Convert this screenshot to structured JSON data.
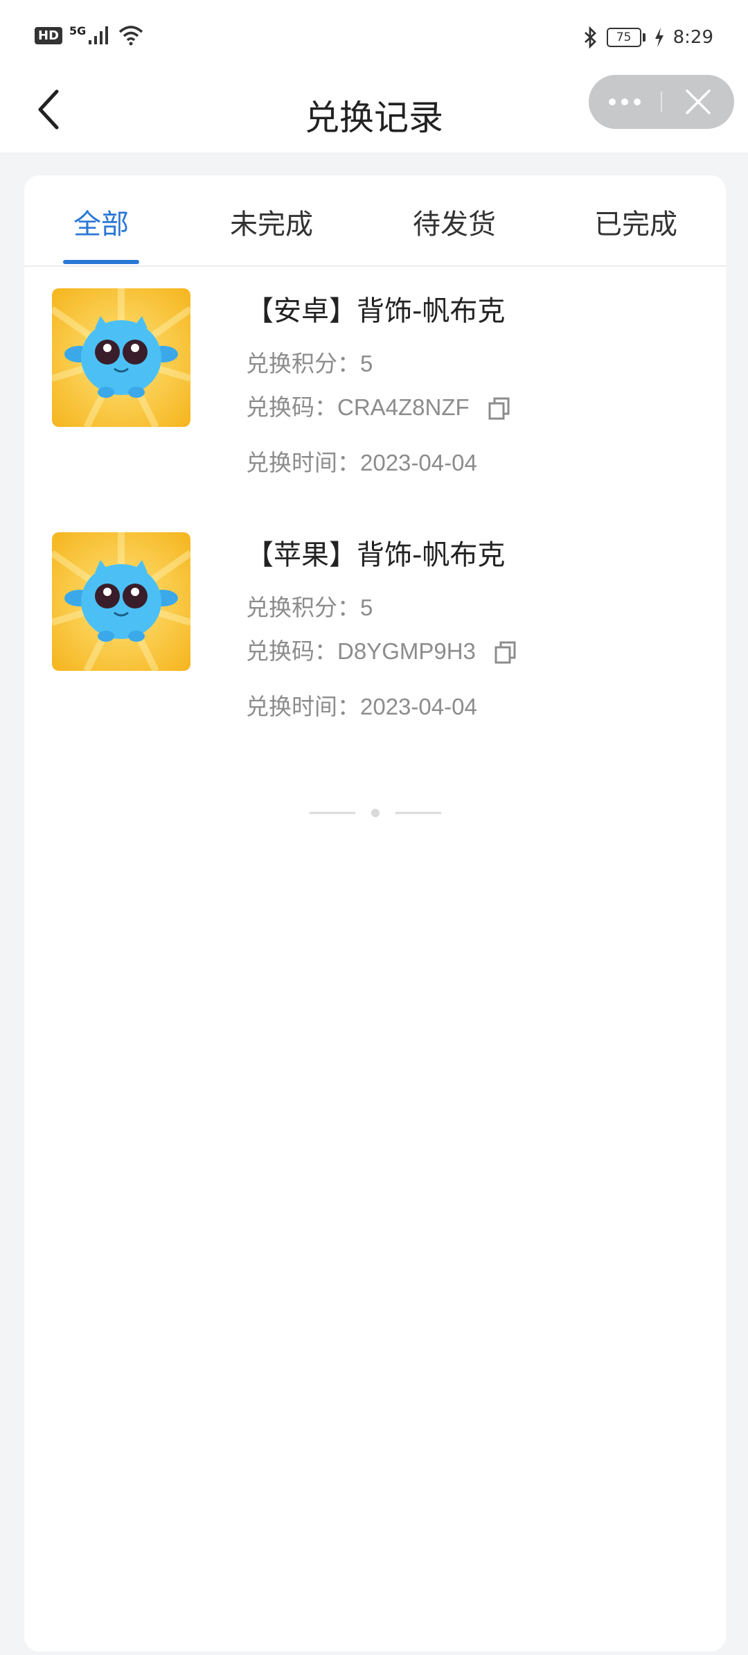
{
  "status_bar": {
    "left_badge": "HD",
    "network": "5G",
    "battery_level": "75",
    "time": "8:29"
  },
  "nav": {
    "title": "兑换记录",
    "icons": [
      "back-chevron-icon",
      "more-dots-icon",
      "close-icon"
    ]
  },
  "tabs": [
    {
      "label": "全部",
      "active": true
    },
    {
      "label": "未完成",
      "active": false
    },
    {
      "label": "待发货",
      "active": false
    },
    {
      "label": "已完成",
      "active": false
    }
  ],
  "records": [
    {
      "title": "【安卓】背饰-帆布克",
      "points_label": "兑换积分：",
      "points": "5",
      "code_label": "兑换码：",
      "code": "CRA4Z8NZF",
      "time_label": "兑换时间：",
      "time": "2023-04-04"
    },
    {
      "title": "【苹果】背饰-帆布克",
      "points_label": "兑换积分：",
      "points": "5",
      "code_label": "兑换码：",
      "code": "D8YGMP9H3",
      "time_label": "兑换时间：",
      "time": "2023-04-04"
    }
  ],
  "colors": {
    "accent": "#2a77d6",
    "background": "#f3f4f6",
    "card": "#ffffff",
    "muted_text": "#8c8c8c",
    "capsule": "#c7c8ca"
  }
}
